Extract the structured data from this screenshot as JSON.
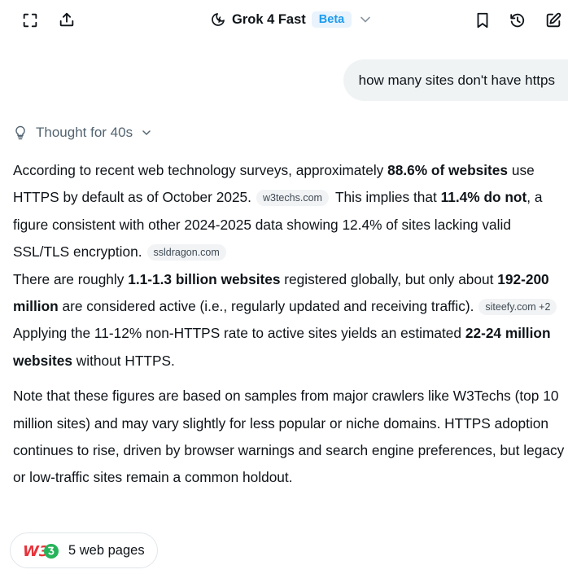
{
  "header": {
    "model_name": "Grok 4 Fast",
    "badge": "Beta",
    "icons": [
      "fullscreen-icon",
      "share-icon",
      "moon-lightning-icon",
      "chevron-down-icon",
      "bookmark-icon",
      "history-icon",
      "edit-icon"
    ]
  },
  "user_message": "how many sites don't have https",
  "thought_label": "Thought for 40s",
  "answer": {
    "p1": {
      "t1": "According to recent web technology surveys, approximately ",
      "b1": "88.6% of websites",
      "t2": " use HTTPS by default as of October 2025.",
      "c1": "w3techs.com",
      "t3": "This implies that ",
      "b2": "11.4% do not",
      "t4": ", a figure consistent with other 2024-2025 data showing 12.4% of sites lacking valid SSL/TLS encryption.",
      "c2": "ssldragon.com",
      "t5": "There are roughly ",
      "b3": "1.1-1.3 billion websites",
      "t6": " registered globally, but only about ",
      "b4": "192-200 million",
      "t7": " are considered active (i.e., regularly updated and receiving traffic).",
      "c3": "siteefy.com +2",
      "t8": "Applying the 11-12% non-HTTPS rate to active sites yields an estimated ",
      "b5": "22-24 million websites",
      "t9": " without HTTPS."
    },
    "p2": "Note that these figures are based on samples from major crawlers like W3Techs (top 10 million sites) and may vary slightly for less popular or niche domains. HTTPS adoption continues to rise, driven by browser warnings and search engine preferences, but legacy or low-traffic sites remain a common holdout."
  },
  "sources": {
    "label": "5 web pages",
    "logo_text": "W3"
  },
  "colors": {
    "accent": "#1d9bf0",
    "text": "#0f1419",
    "muted": "#536471",
    "bubble": "#eff3f4",
    "w3c_red": "#e8333a",
    "w3c_green": "#27b35a"
  }
}
